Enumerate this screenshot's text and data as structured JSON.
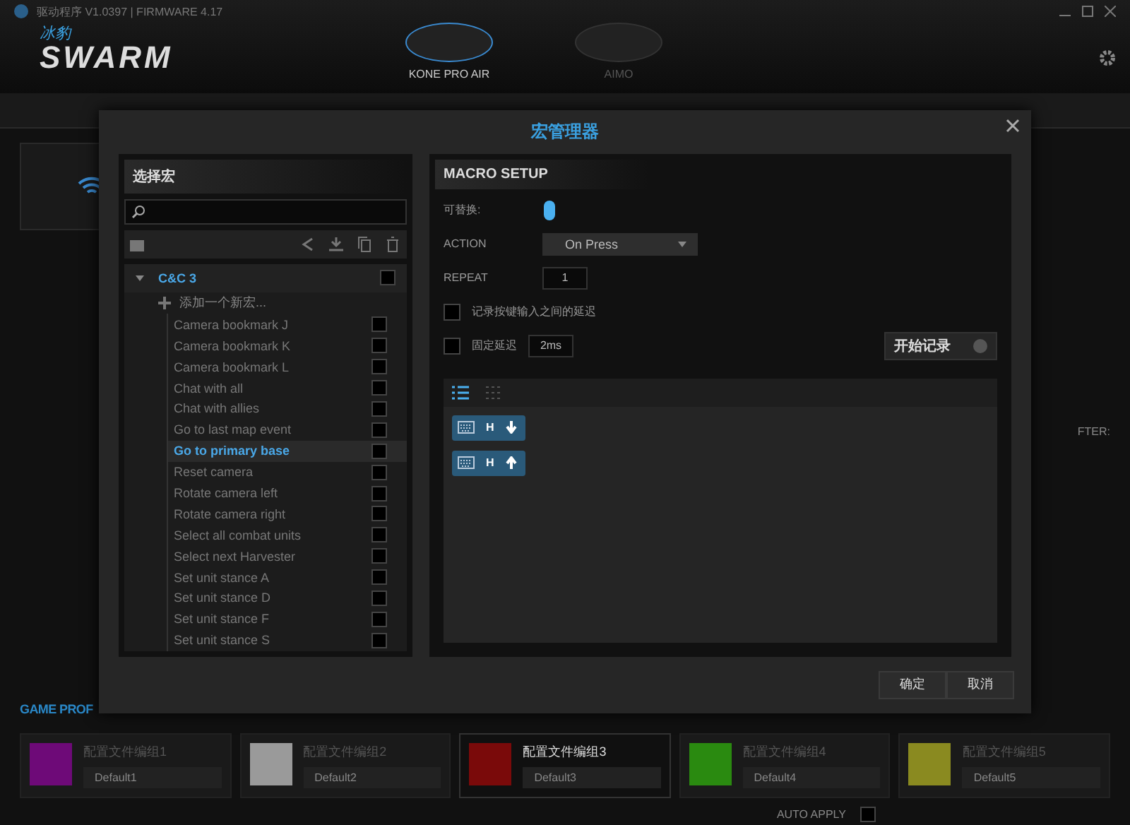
{
  "window": {
    "title": "驱动程序 V1.0397 | FIRMWARE 4.17"
  },
  "logo": {
    "top": "冰豹",
    "main": "SWARM"
  },
  "devices": [
    {
      "name": "KONE PRO AIR",
      "selected": true
    },
    {
      "name": "AIMO",
      "selected": false
    }
  ],
  "game_profiles": {
    "title": "GAME PROF",
    "profiles": [
      {
        "name": "配置文件编组1",
        "value": "Default1",
        "color": "#6e0a78",
        "selected": false
      },
      {
        "name": "配置文件编组2",
        "value": "Default2",
        "color": "#9a9a9a",
        "selected": false
      },
      {
        "name": "配置文件编组3",
        "value": "Default3",
        "color": "#7a0a0a",
        "selected": true
      },
      {
        "name": "配置文件编组4",
        "value": "Default4",
        "color": "#2a8a10",
        "selected": false
      },
      {
        "name": "配置文件编组5",
        "value": "Default5",
        "color": "#8a8a20",
        "selected": false
      }
    ]
  },
  "auto_apply": {
    "label": "AUTO APPLY",
    "checked": false
  },
  "side_label": "FTER:",
  "dialog": {
    "title": "宏管理器",
    "left": {
      "title": "选择宏",
      "add_label": "添加一个新宏...",
      "groups": [
        {
          "name": "C&C 3",
          "expanded": true,
          "children": [
            {
              "name": "Camera bookmark J",
              "selected": false
            },
            {
              "name": "Camera bookmark K",
              "selected": false
            },
            {
              "name": "Camera bookmark L",
              "selected": false
            },
            {
              "name": "Chat with all",
              "selected": false
            },
            {
              "name": "Chat with allies",
              "selected": false
            },
            {
              "name": "Go to last map event",
              "selected": false
            },
            {
              "name": "Go to primary base",
              "selected": true
            },
            {
              "name": "Reset camera",
              "selected": false
            },
            {
              "name": "Rotate camera left",
              "selected": false
            },
            {
              "name": "Rotate camera right",
              "selected": false
            },
            {
              "name": "Select all combat units",
              "selected": false
            },
            {
              "name": "Select next Harvester",
              "selected": false
            },
            {
              "name": "Set unit stance A",
              "selected": false
            },
            {
              "name": "Set unit stance D",
              "selected": false
            },
            {
              "name": "Set unit stance F",
              "selected": false
            },
            {
              "name": "Set unit stance S",
              "selected": false
            }
          ]
        }
      ]
    },
    "setup": {
      "title": "MACRO SETUP",
      "assign_label": "可替换:",
      "action_label": "ACTION",
      "action_value": "On Press",
      "repeat_label": "REPEAT",
      "repeat_value": "1",
      "options": [
        {
          "label": "记录按键输入之间的延迟",
          "checked": false
        },
        {
          "label": "固定延迟",
          "checked": false,
          "value": "2ms"
        }
      ],
      "record_button": "开始记录",
      "events": [
        {
          "key": "H",
          "kind": "keydown"
        },
        {
          "key": "H",
          "kind": "keyup"
        }
      ]
    },
    "buttons": [
      "确定",
      "取消"
    ]
  }
}
